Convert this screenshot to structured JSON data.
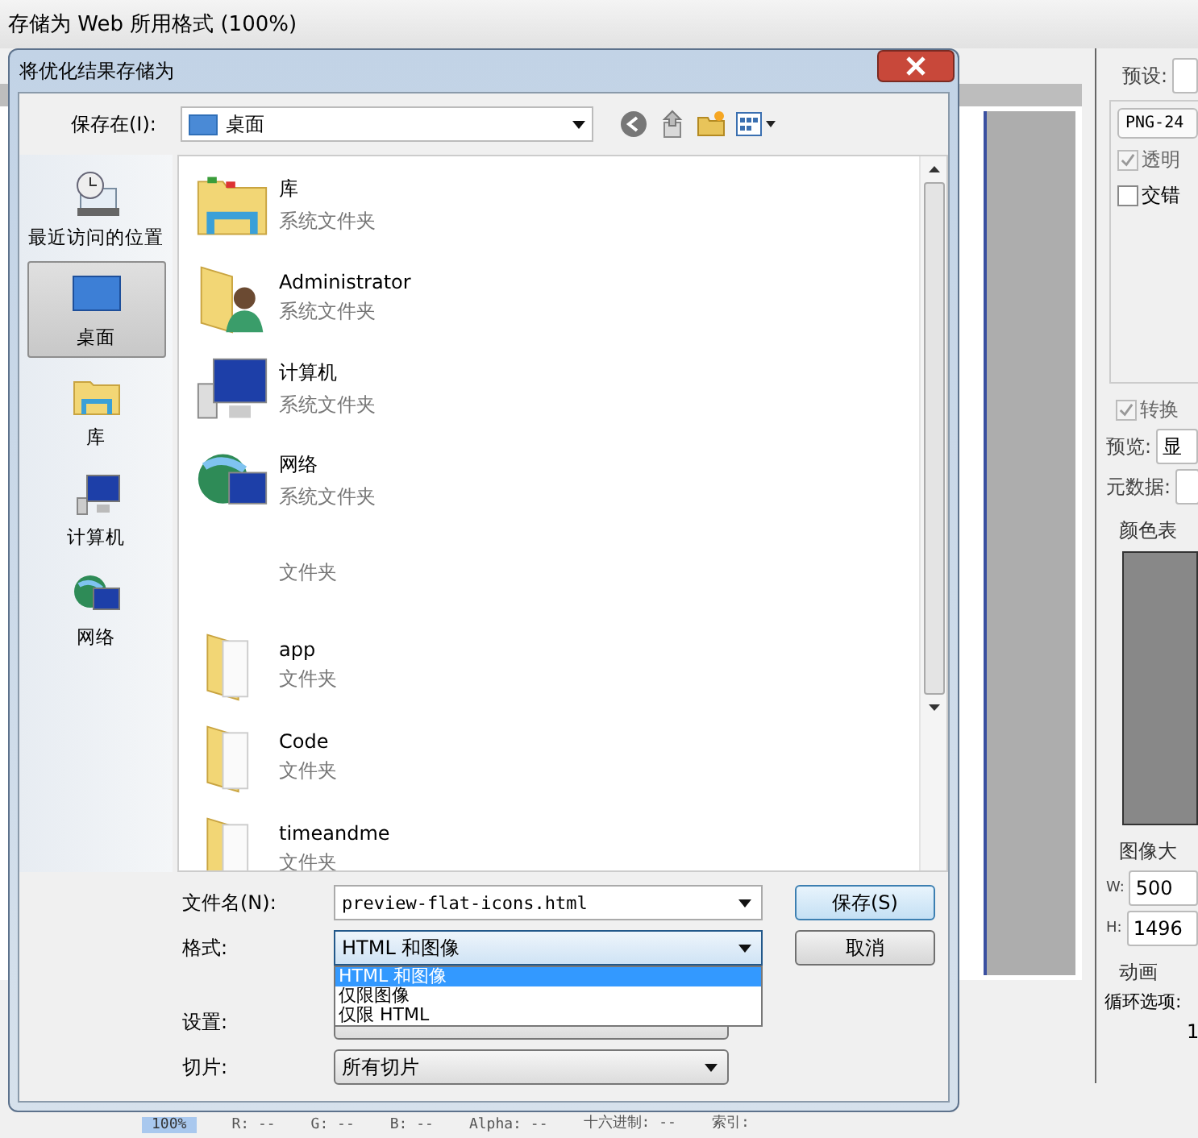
{
  "window": {
    "title": "存储为 Web 所用格式 (100%)"
  },
  "right_panel": {
    "preset_label": "预设:",
    "format_value": "PNG-24",
    "options": [
      {
        "label": "透明",
        "checked": true,
        "disabled": true
      },
      {
        "label": "交错",
        "checked": false,
        "disabled": false
      }
    ],
    "convert": {
      "label": "转换",
      "checked": true,
      "disabled": true
    },
    "preview_label": "预览:",
    "preview_value": "显",
    "metadata_label": "元数据:",
    "color_table_title": "颜色表",
    "image_size_title": "图像大",
    "width_label": "W:",
    "width_value": "500",
    "height_label": "H:",
    "height_value": "1496",
    "animation_title": "动画",
    "loop_label": "循环选项:",
    "frame_counter": "1"
  },
  "status_bar": {
    "zoom": "100%",
    "readouts": [
      "R: --",
      "G: --",
      "B: --",
      "Alpha: --",
      "十六进制: --",
      "索引:"
    ]
  },
  "dialog": {
    "title": "将优化结果存储为",
    "save_in": {
      "label": "保存在(I):",
      "value": "桌面"
    },
    "places": [
      {
        "label": "最近访问的位置",
        "kind": "recent",
        "selected": false
      },
      {
        "label": "桌面",
        "kind": "desktop",
        "selected": true
      },
      {
        "label": "库",
        "kind": "library",
        "selected": false
      },
      {
        "label": "计算机",
        "kind": "computer",
        "selected": false
      },
      {
        "label": "网络",
        "kind": "network",
        "selected": false
      }
    ],
    "files": [
      {
        "name": "库",
        "type": "系统文件夹",
        "kind": "library"
      },
      {
        "name": "Administrator",
        "type": "系统文件夹",
        "kind": "user"
      },
      {
        "name": "计算机",
        "type": "系统文件夹",
        "kind": "computer"
      },
      {
        "name": "网络",
        "type": "系统文件夹",
        "kind": "network"
      },
      {
        "type": "文件夹",
        "kind": "none"
      },
      {
        "name": "app",
        "type": "文件夹",
        "kind": "folder"
      },
      {
        "name": "Code",
        "type": "文件夹",
        "kind": "folder"
      },
      {
        "name": "timeandme",
        "type": "文件夹",
        "kind": "folder"
      }
    ],
    "filename": {
      "label": "文件名(N):",
      "value": "preview-flat-icons.html"
    },
    "format": {
      "label": "格式:",
      "value": "HTML 和图像",
      "expanded": true,
      "options": [
        {
          "label": "HTML 和图像",
          "selected": true
        },
        {
          "label": "仅限图像",
          "selected": false
        },
        {
          "label": "仅限 HTML",
          "selected": false
        }
      ]
    },
    "settings": {
      "label": "设置:"
    },
    "slices": {
      "label": "切片:",
      "value": "所有切片"
    },
    "buttons": [
      {
        "label": "保存(S)",
        "focused": true
      },
      {
        "label": "取消",
        "focused": false
      }
    ]
  }
}
